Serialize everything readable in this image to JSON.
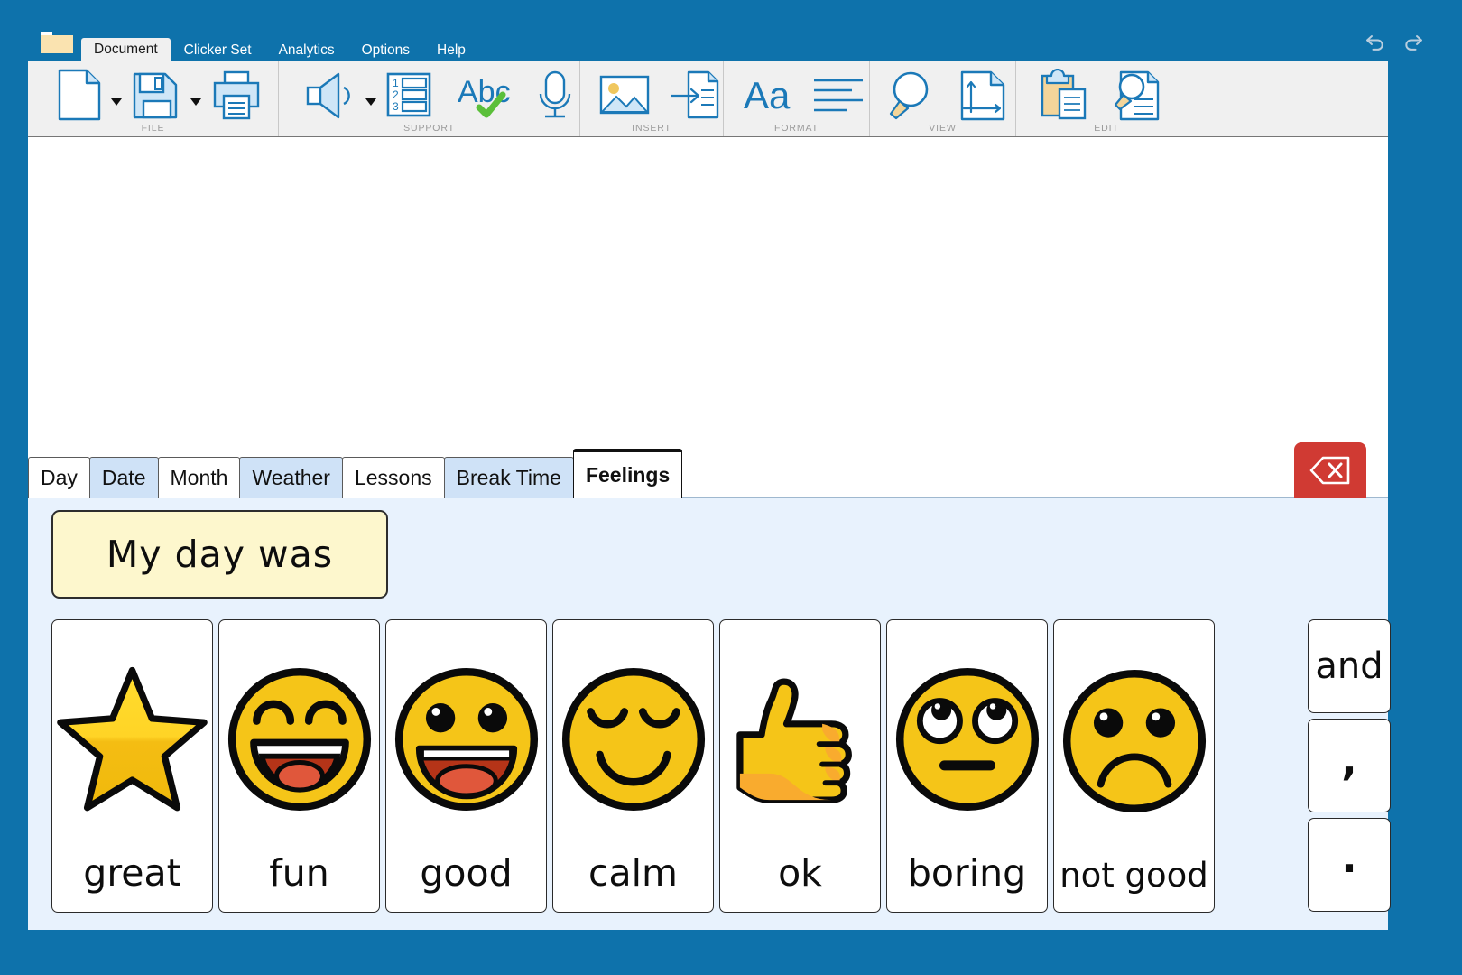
{
  "window": {
    "folder_icon": "folder-icon",
    "undo_label": "undo",
    "redo_label": "redo"
  },
  "menubar": {
    "tabs": [
      {
        "label": "Document",
        "active": true
      },
      {
        "label": "Clicker Set",
        "active": false
      },
      {
        "label": "Analytics",
        "active": false
      },
      {
        "label": "Options",
        "active": false
      },
      {
        "label": "Help",
        "active": false
      }
    ]
  },
  "ribbon": {
    "groups": [
      {
        "label": "FILE",
        "buttons": [
          {
            "name": "new-document-button",
            "icon": "new-page-icon",
            "caret": true
          },
          {
            "name": "save-button",
            "icon": "floppy-disk-icon",
            "caret": true
          },
          {
            "name": "print-button",
            "icon": "printer-icon",
            "caret": false
          }
        ]
      },
      {
        "label": "SUPPORT",
        "buttons": [
          {
            "name": "speak-button",
            "icon": "speaker-icon",
            "caret": true
          },
          {
            "name": "word-bank-button",
            "icon": "numbered-list-icon",
            "caret": false
          },
          {
            "name": "spell-check-button",
            "icon": "abc-check-icon",
            "caret": false
          },
          {
            "name": "voice-notes-button",
            "icon": "microphone-icon",
            "caret": false
          }
        ]
      },
      {
        "label": "INSERT",
        "buttons": [
          {
            "name": "insert-picture-button",
            "icon": "picture-icon",
            "caret": false
          },
          {
            "name": "insert-page-button",
            "icon": "insert-page-icon",
            "caret": false
          }
        ]
      },
      {
        "label": "FORMAT",
        "buttons": [
          {
            "name": "font-button",
            "icon": "font-aa-icon",
            "caret": false
          },
          {
            "name": "paragraph-button",
            "icon": "align-lines-icon",
            "caret": false
          }
        ]
      },
      {
        "label": "VIEW",
        "buttons": [
          {
            "name": "zoom-button",
            "icon": "magnifier-icon",
            "caret": false
          },
          {
            "name": "page-layout-button",
            "icon": "page-axes-icon",
            "caret": false
          }
        ]
      },
      {
        "label": "EDIT",
        "buttons": [
          {
            "name": "paste-button",
            "icon": "clipboard-icon",
            "caret": false
          },
          {
            "name": "find-replace-button",
            "icon": "document-search-icon",
            "caret": false
          }
        ]
      }
    ]
  },
  "document": {
    "content": ""
  },
  "gridset": {
    "tabs": [
      {
        "label": "Day",
        "style": "white",
        "active": false
      },
      {
        "label": "Date",
        "style": "blue",
        "active": false
      },
      {
        "label": "Month",
        "style": "white",
        "active": false
      },
      {
        "label": "Weather",
        "style": "blue",
        "active": false
      },
      {
        "label": "Lessons",
        "style": "white",
        "active": false
      },
      {
        "label": "Break Time",
        "style": "blue",
        "active": false
      },
      {
        "label": "Feelings",
        "style": "white",
        "active": true
      }
    ],
    "delete_key": {
      "name": "backspace-key",
      "icon": "backspace-icon"
    },
    "sentence_starter": "My day was",
    "cards": [
      {
        "label": "great",
        "art": "star"
      },
      {
        "label": "fun",
        "art": "laughing-face"
      },
      {
        "label": "good",
        "art": "happy-face"
      },
      {
        "label": "calm",
        "art": "relaxed-face"
      },
      {
        "label": "ok",
        "art": "thumbs-up"
      },
      {
        "label": "boring",
        "art": "eye-roll-face"
      },
      {
        "label": "not good",
        "art": "sad-face"
      }
    ],
    "punctuation": [
      {
        "label": "and",
        "kind": "word"
      },
      {
        "label": ",",
        "kind": "sym"
      },
      {
        "label": ".",
        "kind": "dot"
      }
    ]
  },
  "colors": {
    "frame_blue": "#0e72ab",
    "ribbon_bg": "#f0f0f0",
    "grid_panel_bg": "#e8f2fd",
    "tab_blue": "#cfe2f7",
    "sentence_yellow": "#fdf7cd",
    "delete_red": "#d03a33",
    "emoji_yellow": "#f5c518",
    "icon_blue": "#1b79b8"
  }
}
